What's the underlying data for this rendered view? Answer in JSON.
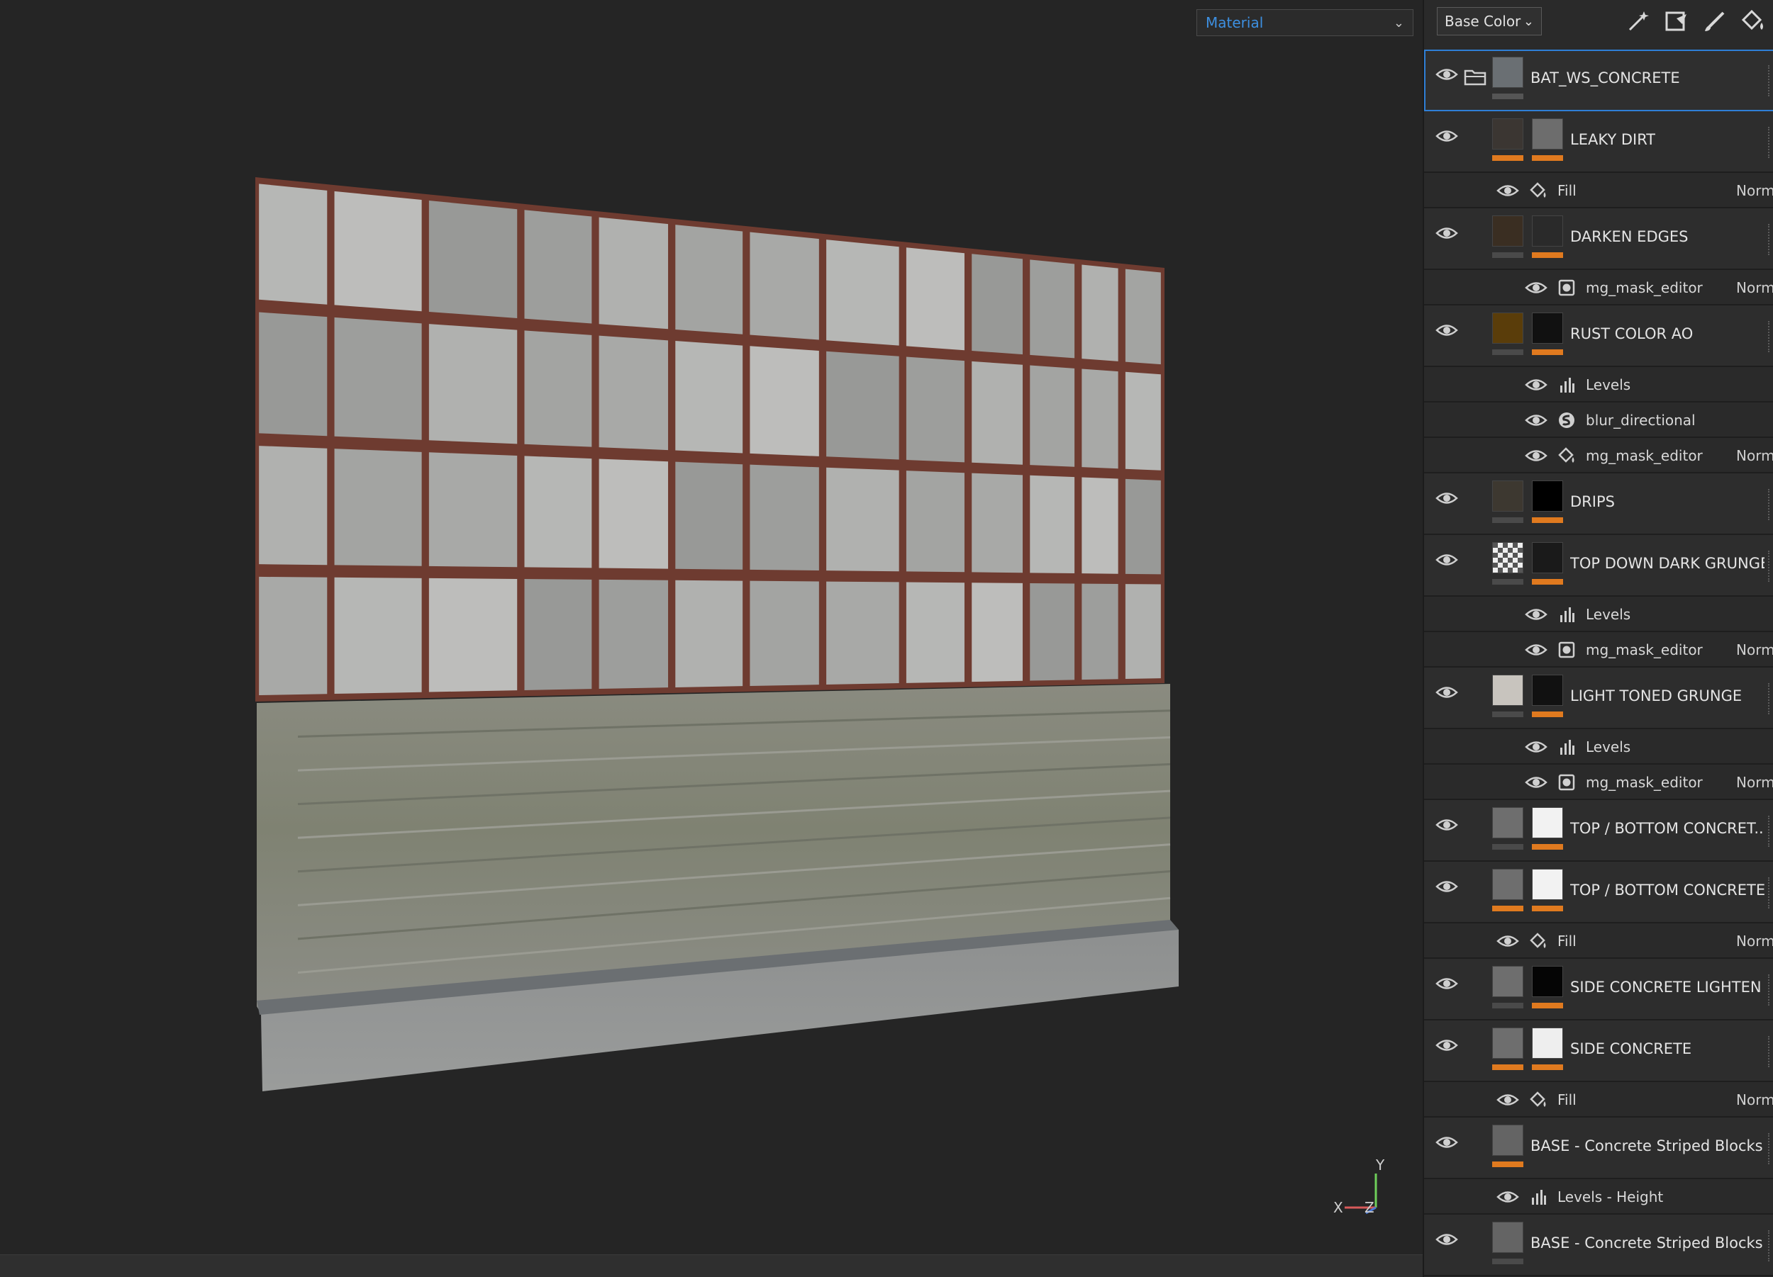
{
  "viewport": {
    "material_dropdown": "Material",
    "axis": {
      "y": "Y",
      "x": "X",
      "z": "Z"
    }
  },
  "toolbar": {
    "channel_dropdown": "Base Color",
    "tools": [
      "magic-wand-icon",
      "fill-projection-icon",
      "brush-icon",
      "fill-bucket-icon"
    ]
  },
  "layers": [
    {
      "kind": "folder",
      "name": "BAT_WS_CONCRETE",
      "selected": true,
      "thumb": "#6a6f73",
      "bar": "#555555"
    },
    {
      "kind": "layer",
      "name": "LEAKY DIRT",
      "thumb": "#3b3632",
      "mask": "#6d6d6d",
      "bar1": "#e07a1f",
      "bar2": "#e07a1f"
    },
    {
      "kind": "sub",
      "indent": 1,
      "icon": "fill-bucket-icon",
      "name": "Fill",
      "blend": "Norm"
    },
    {
      "kind": "layer",
      "name": "DARKEN EDGES",
      "thumb": "#3a2e22",
      "mask": "#2a2a2a",
      "bar1": "#4a4a4a",
      "bar2": "#e07a1f"
    },
    {
      "kind": "sub",
      "indent": 2,
      "icon": "mask-icon",
      "name": "mg_mask_editor",
      "blend": "Norm"
    },
    {
      "kind": "layer",
      "name": "RUST COLOR AO",
      "thumb": "#5a3d0a",
      "mask": "#111111",
      "bar1": "#4a4a4a",
      "bar2": "#e07a1f"
    },
    {
      "kind": "sub",
      "indent": 2,
      "icon": "levels-icon",
      "name": "Levels",
      "blend": ""
    },
    {
      "kind": "sub",
      "indent": 2,
      "icon": "blur-icon",
      "name": "blur_directional",
      "blend": ""
    },
    {
      "kind": "sub",
      "indent": 2,
      "icon": "fill-bucket-icon",
      "name": "mg_mask_editor",
      "blend": "Norm"
    },
    {
      "kind": "layer",
      "name": "DRIPS",
      "thumb": "#3d3830",
      "mask": "#000000",
      "bar1": "#4a4a4a",
      "bar2": "#e07a1f"
    },
    {
      "kind": "layer",
      "name": "TOP DOWN DARK GRUNGE",
      "thumb": "checker",
      "mask": "#1a1a1a",
      "bar1": "#4a4a4a",
      "bar2": "#e07a1f"
    },
    {
      "kind": "sub",
      "indent": 2,
      "icon": "levels-icon",
      "name": "Levels",
      "blend": ""
    },
    {
      "kind": "sub",
      "indent": 2,
      "icon": "mask-icon",
      "name": "mg_mask_editor",
      "blend": "Norm"
    },
    {
      "kind": "layer",
      "name": "LIGHT TONED GRUNGE",
      "thumb": "#c8c4be",
      "mask": "#111111",
      "bar1": "#4a4a4a",
      "bar2": "#e07a1f"
    },
    {
      "kind": "sub",
      "indent": 2,
      "icon": "levels-icon",
      "name": "Levels",
      "blend": ""
    },
    {
      "kind": "sub",
      "indent": 2,
      "icon": "mask-icon",
      "name": "mg_mask_editor",
      "blend": "Norm"
    },
    {
      "kind": "layer",
      "name": "TOP / BOTTOM CONCRET...",
      "thumb": "#6e6e6e",
      "mask": "#f2f2f2",
      "bar1": "#4a4a4a",
      "bar2": "#e07a1f"
    },
    {
      "kind": "layer",
      "name": "TOP / BOTTOM CONCRETE",
      "thumb": "#6e6e6e",
      "mask": "#f2f2f2",
      "bar1": "#e07a1f",
      "bar2": "#e07a1f"
    },
    {
      "kind": "sub",
      "indent": 1,
      "icon": "fill-bucket-icon",
      "name": "Fill",
      "blend": "Norm"
    },
    {
      "kind": "layer",
      "name": "SIDE CONCRETE LIGHTEN",
      "thumb": "#6e6e6e",
      "mask": "#050505",
      "bar1": "#4a4a4a",
      "bar2": "#e07a1f"
    },
    {
      "kind": "layer",
      "name": "SIDE CONCRETE",
      "thumb": "#6e6e6e",
      "mask": "#eeeeee",
      "bar1": "#e07a1f",
      "bar2": "#e07a1f"
    },
    {
      "kind": "sub",
      "indent": 1,
      "icon": "fill-bucket-icon",
      "name": "Fill",
      "blend": "Norm"
    },
    {
      "kind": "layer-single",
      "name": "BASE - Concrete Striped Blocks c...",
      "thumb": "#646464",
      "bar1": "#e07a1f"
    },
    {
      "kind": "sub",
      "indent": 1,
      "icon": "levels-icon",
      "name": "Levels - Height",
      "blend": ""
    },
    {
      "kind": "layer-single",
      "name": "BASE - Concrete Striped Blocks",
      "thumb": "#646464",
      "bar1": "#4a4a4a"
    }
  ]
}
